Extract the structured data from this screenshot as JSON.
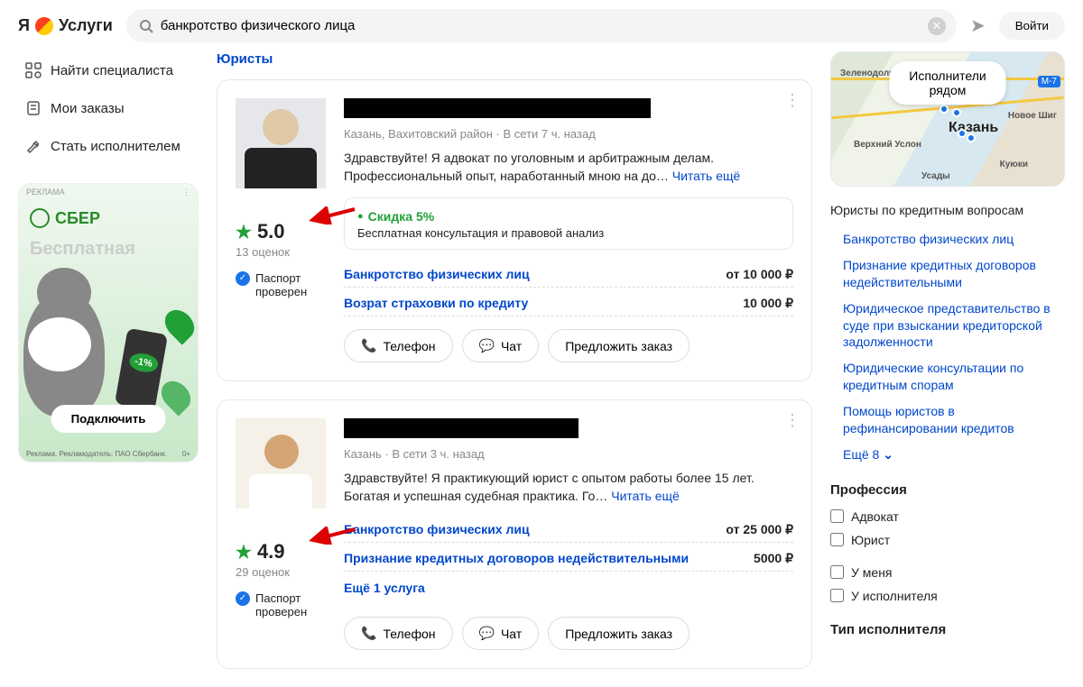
{
  "header": {
    "logo_text": "Услуги",
    "search_value": "банкротство физического лица",
    "login": "Войти"
  },
  "sidebar": {
    "items": [
      {
        "label": "Найти специалиста"
      },
      {
        "label": "Мои заказы"
      },
      {
        "label": "Стать исполнителем"
      }
    ],
    "ad": {
      "badge": "РЕКЛАМА",
      "brand": "СБЕР",
      "title": "Бесплатная",
      "discount": "-1%",
      "cta": "Подключить",
      "legal": "Реклама. Рекламодатель: ПАО Сбербанк.",
      "age": "0+"
    }
  },
  "content": {
    "title": "Юристы",
    "cards": [
      {
        "meta": "Казань, Вахитовский район  ·  В сети 7 ч. назад",
        "desc": "Здравствуйте! Я адвокат по уголовным и арбитражным делам. Профессиональный опыт, наработанный мною на до… ",
        "read_more": "Читать ещё",
        "rating": "5.0",
        "rating_count": "13 оценок",
        "verified": "Паспорт проверен",
        "promo_badge": "Скидка 5%",
        "promo_sub": "Бесплатная консультация и правовой анализ",
        "services": [
          {
            "name": "Банкротство физических лиц",
            "price": "от 10 000 ₽"
          },
          {
            "name": "Возрат страховки по кредиту",
            "price": "10 000 ₽"
          }
        ]
      },
      {
        "meta": "Казань  ·  В сети 3 ч. назад",
        "desc": "Здравствуйте! Я практикующий юрист с опытом работы более 15 лет. Богатая и успешная судебная практика. Го… ",
        "read_more": "Читать ещё",
        "rating": "4.9",
        "rating_count": "29 оценок",
        "verified": "Паспорт проверен",
        "services": [
          {
            "name": "Банкротство физических лиц",
            "price": "от 25 000 ₽"
          },
          {
            "name": "Признание кредитных договоров недействительными",
            "price": "5000 ₽"
          }
        ],
        "more_services": "Ещё 1 услуга"
      }
    ],
    "actions": {
      "phone": "Телефон",
      "chat": "Чат",
      "offer": "Предложить заказ"
    }
  },
  "right": {
    "map_btn": "Исполнители рядом",
    "map_city": "Казань",
    "map_labels": {
      "s1": "Зеленодольск",
      "s2": "Новое Шиг",
      "s3": "Верхний Услон",
      "s4": "Куюки",
      "s5": "Усады",
      "route": "М-7"
    },
    "filter_title": "Юристы по кредитным вопросам",
    "links": [
      "Банкротство физических лиц",
      "Признание кредитных договоров недействительными",
      "Юридическое представительство в суде при взыскании кредиторской задолженности",
      "Юридические консультации по кредитным спорам",
      "Помощь юристов в рефинансировании кредитов"
    ],
    "more": "Ещё 8",
    "profession_title": "Профессия",
    "professions": [
      "Адвокат",
      "Юрист"
    ],
    "place_opts": [
      "У меня",
      "У исполнителя"
    ],
    "type_title": "Тип исполнителя"
  }
}
